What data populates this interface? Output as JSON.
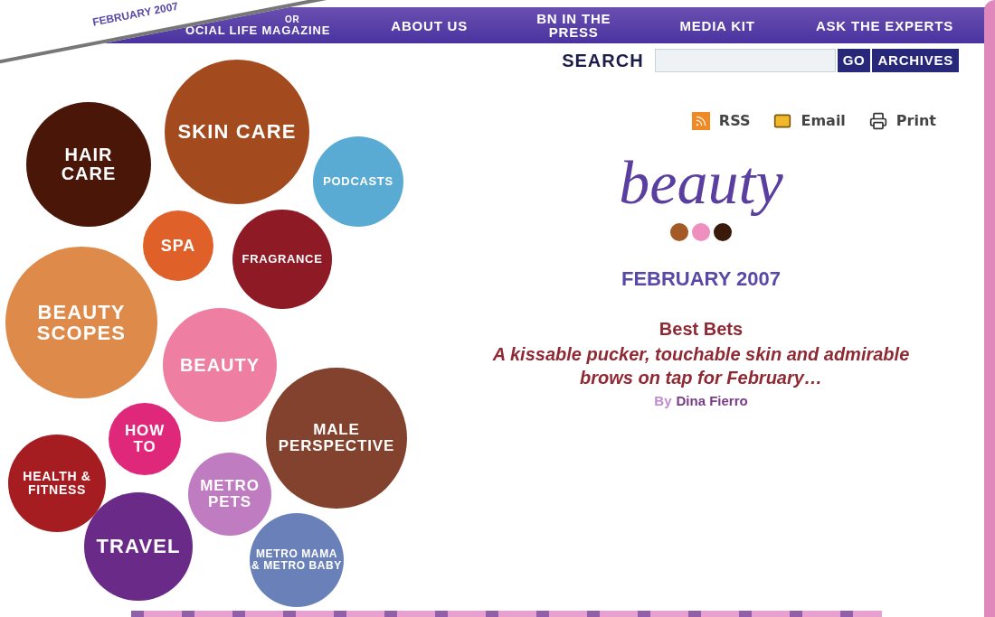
{
  "clipping": {
    "date": "FEBRUARY 2007"
  },
  "nav": {
    "brand_line_1": "OR",
    "brand_line_2": "OCIAL LIFE MAGAZINE",
    "items": [
      "ABOUT US",
      "BN IN THE PRESS",
      "MEDIA KIT",
      "ASK THE EXPERTS"
    ]
  },
  "search": {
    "label": "SEARCH",
    "go": "GO",
    "archives": "ARCHIVES"
  },
  "share": [
    {
      "kind": "rss",
      "label": "RSS"
    },
    {
      "kind": "email",
      "label": "Email"
    },
    {
      "kind": "print",
      "label": "Print"
    }
  ],
  "section_logo": "beauty",
  "issue": "FEBRUARY 2007",
  "article": {
    "title": "Best Bets",
    "teaser": "A kissable pucker, touchable skin and admirable brows on tap for February…",
    "by": "By",
    "author": "Dina Fierro"
  },
  "categories": [
    {
      "label": "HAIR CARE",
      "color": "#4a1608"
    },
    {
      "label": "SKIN CARE",
      "color": "#a34a1e"
    },
    {
      "label": "PODCASTS",
      "color": "#5aabd3"
    },
    {
      "label": "SPA",
      "color": "#e0602a"
    },
    {
      "label": "FRAGRANCE",
      "color": "#8d1a25"
    },
    {
      "label": "BEAUTY SCOPES",
      "color": "#de8a4a"
    },
    {
      "label": "BEAUTY",
      "color": "#ee7fa3"
    },
    {
      "label": "HOW TO",
      "color": "#e0287a"
    },
    {
      "label": "MALE PERSPECTIVE",
      "color": "#82422d"
    },
    {
      "label": "HEALTH & FITNESS",
      "color": "#a51c21"
    },
    {
      "label": "METRO PETS",
      "color": "#c07cc0"
    },
    {
      "label": "TRAVEL",
      "color": "#6a2a88"
    },
    {
      "label": "METRO MAMA & METRO BABY",
      "color": "#6a80b8"
    }
  ]
}
